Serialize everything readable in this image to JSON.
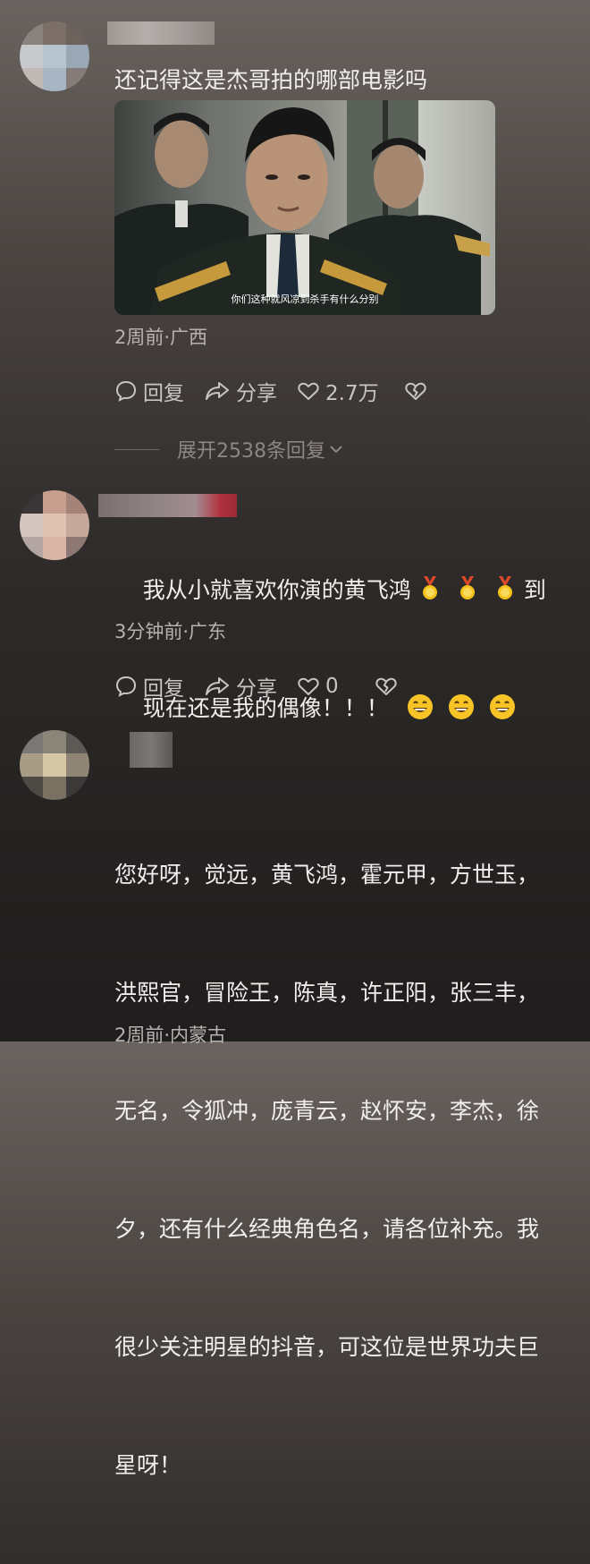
{
  "comments": [
    {
      "text": "还记得这是杰哥拍的哪部电影吗",
      "still_subtitle": "你们这种就风凉到杀手有什么分别",
      "meta": "2周前·广西",
      "reply_label": "回复",
      "share_label": "分享",
      "likes": "2.7万",
      "expand_replies": "展开2538条回复"
    },
    {
      "text_line1": "我从小就喜欢你演的黄飞鸿",
      "text_line1_end": "到",
      "text_line2": "现在还是我的偶像！！！",
      "meta": "3分钟前·广东",
      "reply_label": "回复",
      "share_label": "分享",
      "likes": "0"
    },
    {
      "lines": [
        "您好呀，觉远，黄飞鸿，霍元甲，方世玉，",
        "洪熙官，冒险王，陈真，许正阳，张三丰，",
        "无名，令狐冲，庞青云，赵怀安，李杰，徐",
        "夕，还有什么经典角色名，请各位补充。我",
        "很少关注明星的抖音，可这位是世界功夫巨",
        "星呀！"
      ],
      "meta": "2周前·内蒙古"
    }
  ],
  "icons": {
    "reply": "comment-bubble-icon",
    "share": "share-arrow-icon",
    "like": "heart-icon",
    "dislike": "broken-heart-icon",
    "chevron": "chevron-down-icon",
    "medal": "medal-emoji",
    "smile": "grinning-face-emoji"
  }
}
